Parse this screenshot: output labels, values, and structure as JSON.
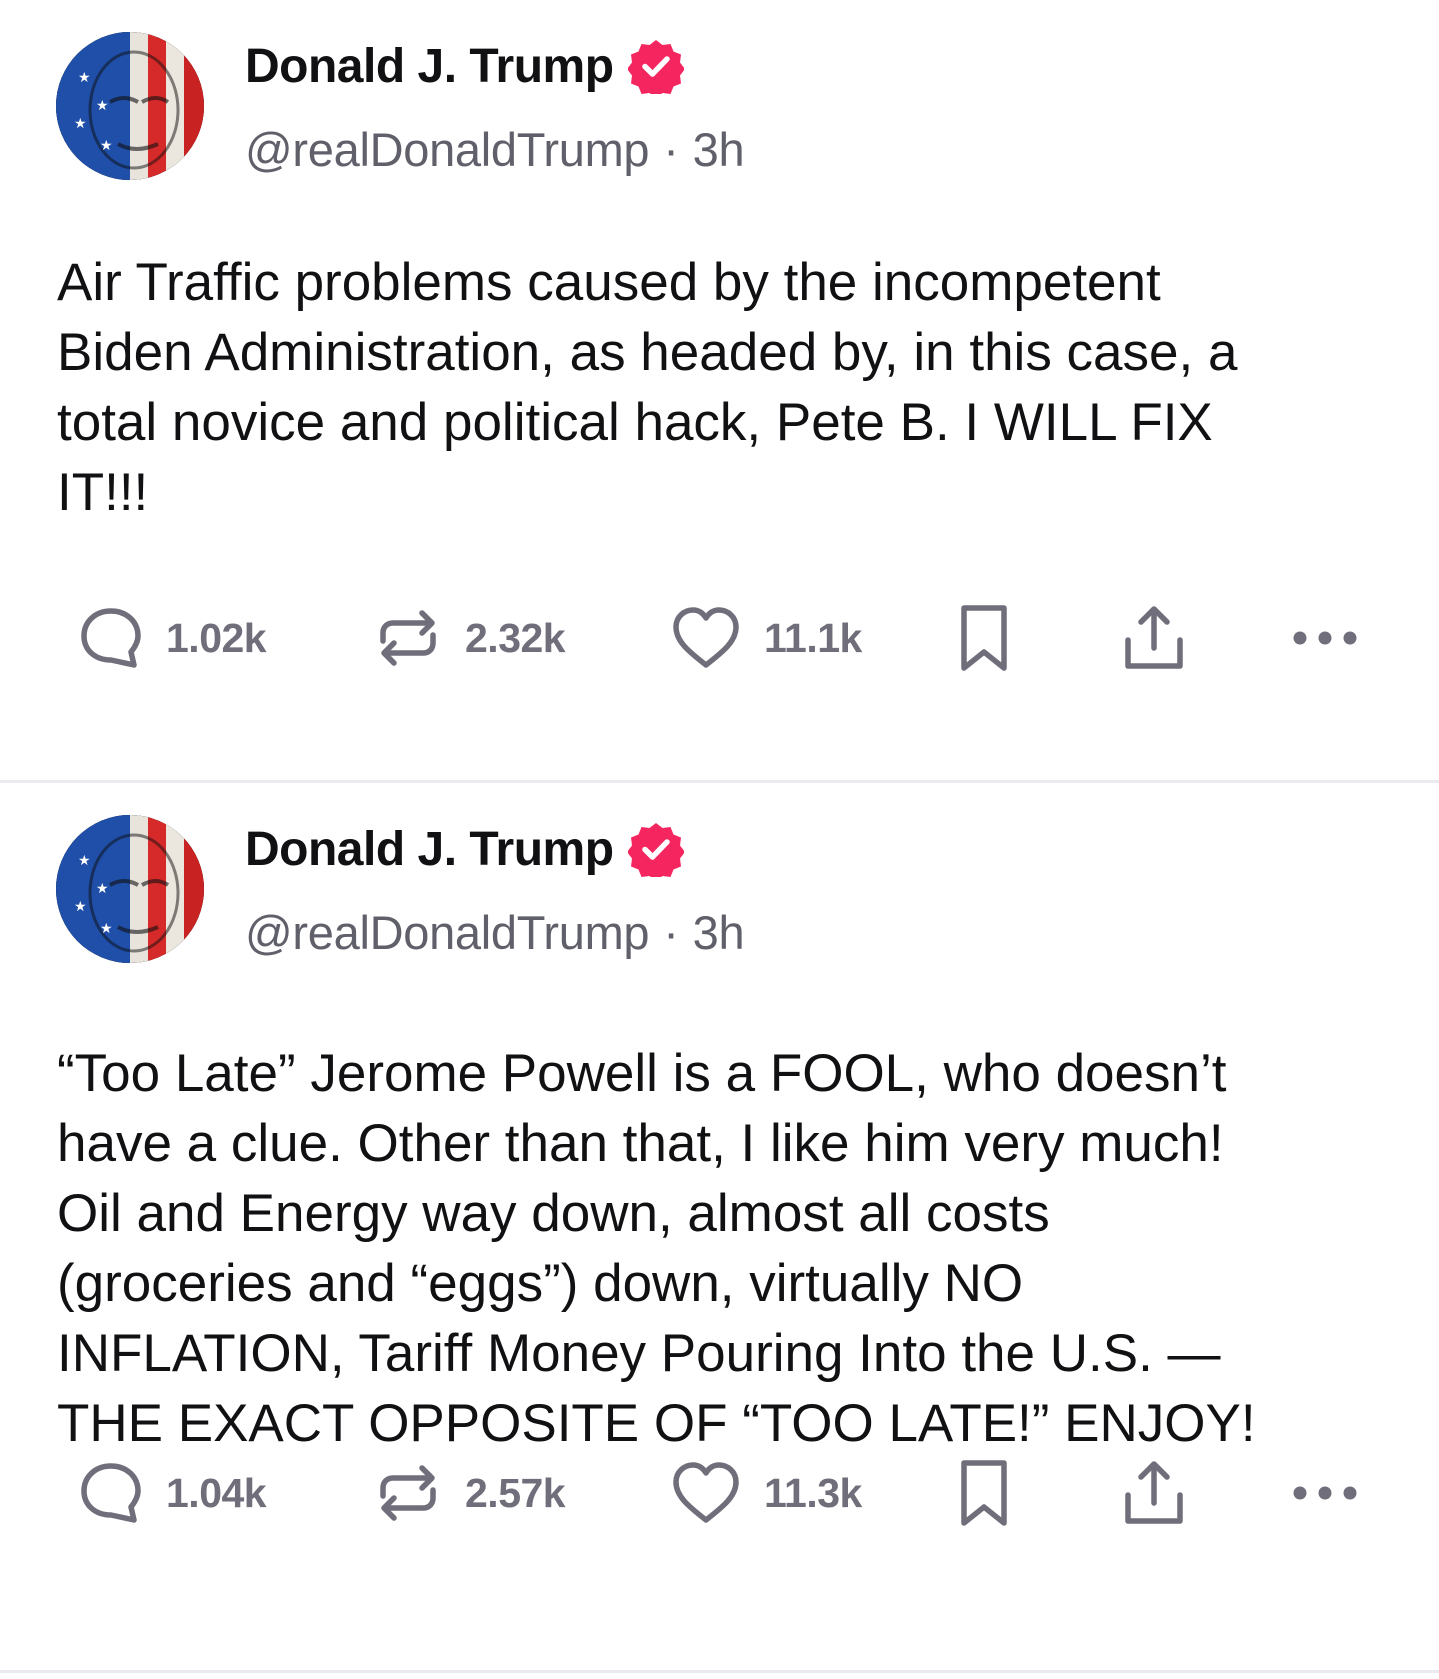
{
  "posts": [
    {
      "author": {
        "name": "Donald J. Trump",
        "handle": "@realDonaldTrump",
        "separator": "·",
        "time": "3h",
        "verified": true
      },
      "text": "Air Traffic problems caused by the incompetent\nBiden Administration, as headed by, in this case, a\ntotal novice and political hack, Pete B. I WILL FIX\nIT!!!",
      "stats": {
        "replies": "1.02k",
        "reposts": "2.32k",
        "likes": "11.1k"
      }
    },
    {
      "author": {
        "name": "Donald J. Trump",
        "handle": "@realDonaldTrump",
        "separator": "·",
        "time": "3h",
        "verified": true
      },
      "text": "“Too Late” Jerome Powell is a FOOL, who doesn’t\nhave a clue. Other than that, I like him very much!\nOil and Energy way down, almost all costs\n(groceries and “eggs”) down, virtually NO\nINFLATION, Tariff Money Pouring Into the U.S. —\nTHE EXACT OPPOSITE OF “TOO LATE!” ENJOY!",
      "stats": {
        "replies": "1.04k",
        "reposts": "2.57k",
        "likes": "11.3k"
      }
    }
  ],
  "colors": {
    "verified": "#f5265f",
    "icon": "#6f6e7a",
    "muted_text": "#60606b",
    "divider": "#eceaf0"
  },
  "icons": {
    "reply": "speech-bubble-icon",
    "repost": "repost-arrows-icon",
    "like": "heart-icon",
    "bookmark": "bookmark-icon",
    "share": "share-upload-icon",
    "more": "ellipsis-icon",
    "verified": "verified-badge-icon"
  }
}
